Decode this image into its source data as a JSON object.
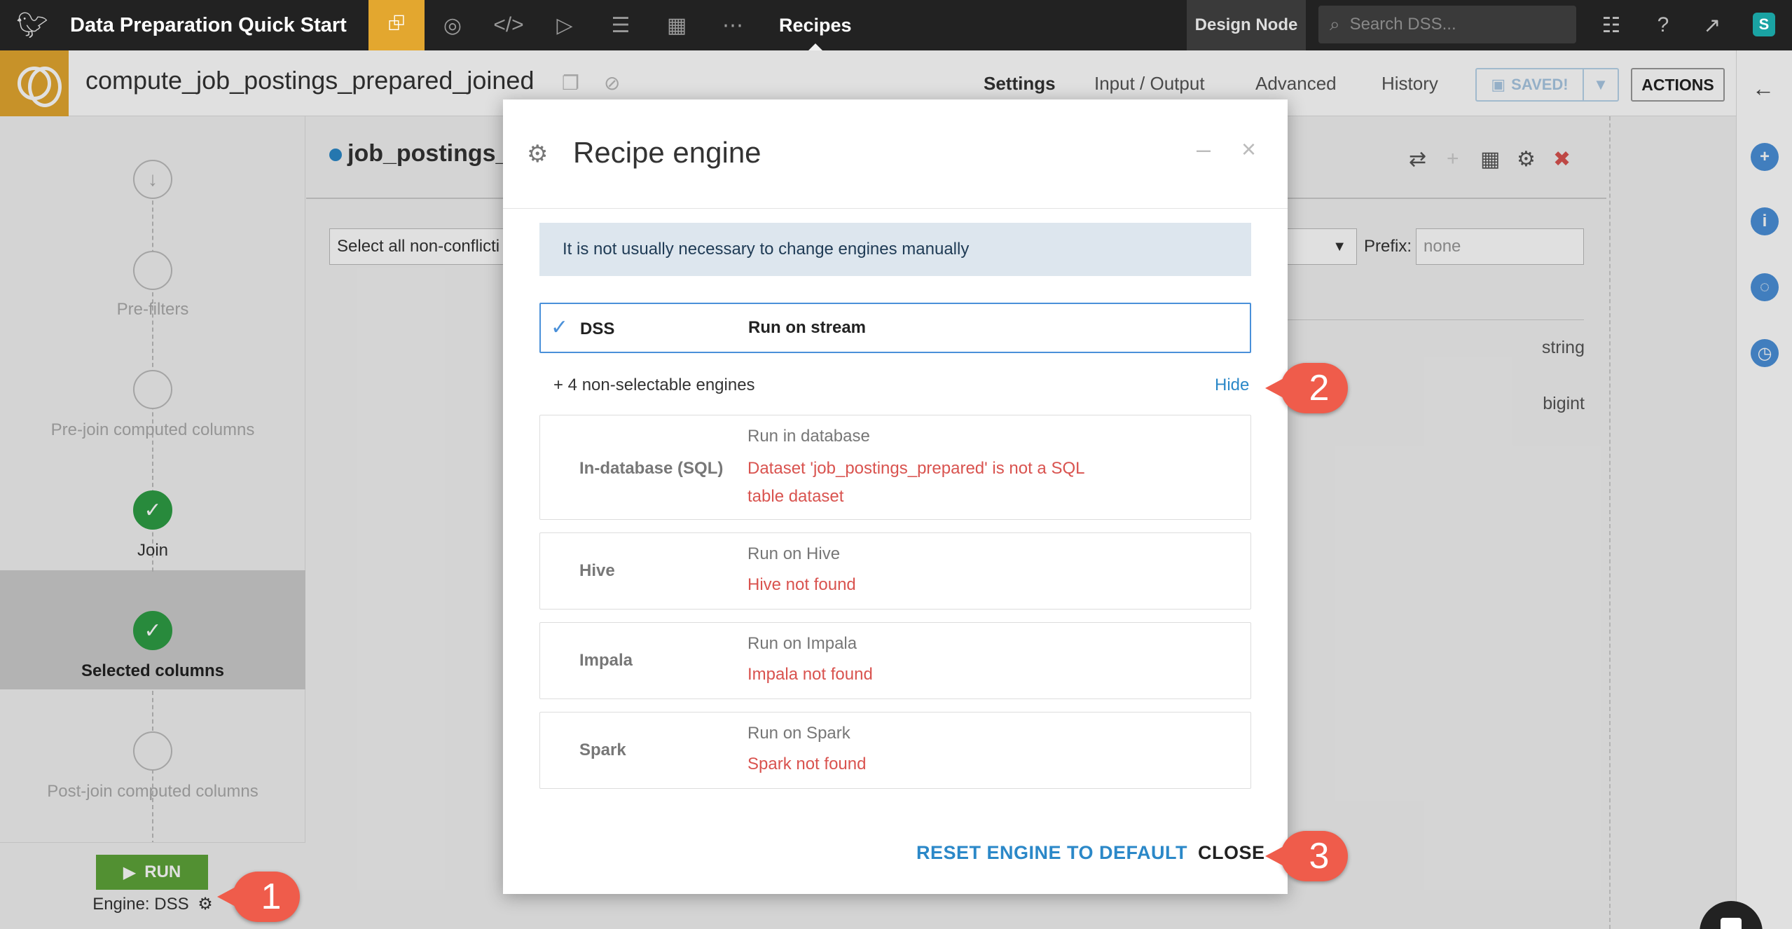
{
  "topbar": {
    "project_title": "Data Preparation Quick Start",
    "nav_icons": [
      "flow-icon",
      "lab-icon",
      "code-icon",
      "run-icon",
      "jobs-icon",
      "dashboard-icon",
      "more-icon"
    ],
    "current_section": "Recipes",
    "node_label": "Design Node",
    "search_placeholder": "Search DSS...",
    "avatar_initial": "S"
  },
  "recipe_header": {
    "name": "compute_job_postings_prepared_joined",
    "tabs": [
      "Settings",
      "Input / Output",
      "Advanced",
      "History"
    ],
    "active_tab": "Settings",
    "saved_label": "SAVED!",
    "actions_label": "ACTIONS"
  },
  "steps": {
    "items": [
      {
        "label": "Pre-filters",
        "state": "pending"
      },
      {
        "label": "Pre-join computed columns",
        "state": "pending"
      },
      {
        "label": "Join",
        "state": "done"
      },
      {
        "label": "Selected columns",
        "state": "done_selected"
      },
      {
        "label": "Post-join computed columns",
        "state": "pending"
      }
    ],
    "run_label": "RUN",
    "engine_label": "Engine: DSS"
  },
  "main": {
    "dataset_title": "job_postings_",
    "select_all": "Select all non-conflicti",
    "prefix_label": "Prefix:",
    "prefix_placeholder": "none",
    "types": [
      "string",
      "bigint"
    ]
  },
  "modal": {
    "title": "Recipe engine",
    "info": "It is not usually necessary to change engines manually",
    "selected_engine": {
      "name": "DSS",
      "desc": "Run on stream"
    },
    "non_selectable_label": "+ 4 non-selectable engines",
    "hide_label": "Hide",
    "engines": [
      {
        "name": "In-database (SQL)",
        "desc": "Run in database",
        "reason": "Dataset 'job_postings_prepared' is not a SQL table dataset"
      },
      {
        "name": "Hive",
        "desc": "Run on Hive",
        "reason": "Hive not found"
      },
      {
        "name": "Impala",
        "desc": "Run on Impala",
        "reason": "Impala not found"
      },
      {
        "name": "Spark",
        "desc": "Run on Spark",
        "reason": "Spark not found"
      }
    ],
    "reset_label": "RESET ENGINE TO DEFAULT",
    "close_label": "CLOSE"
  },
  "callouts": [
    "1",
    "2",
    "3"
  ],
  "colors": {
    "accent": "#e3a72f",
    "link": "#2b88c8",
    "error": "#d9534f",
    "run": "#5ea43a",
    "callout": "#ef5c4b"
  }
}
